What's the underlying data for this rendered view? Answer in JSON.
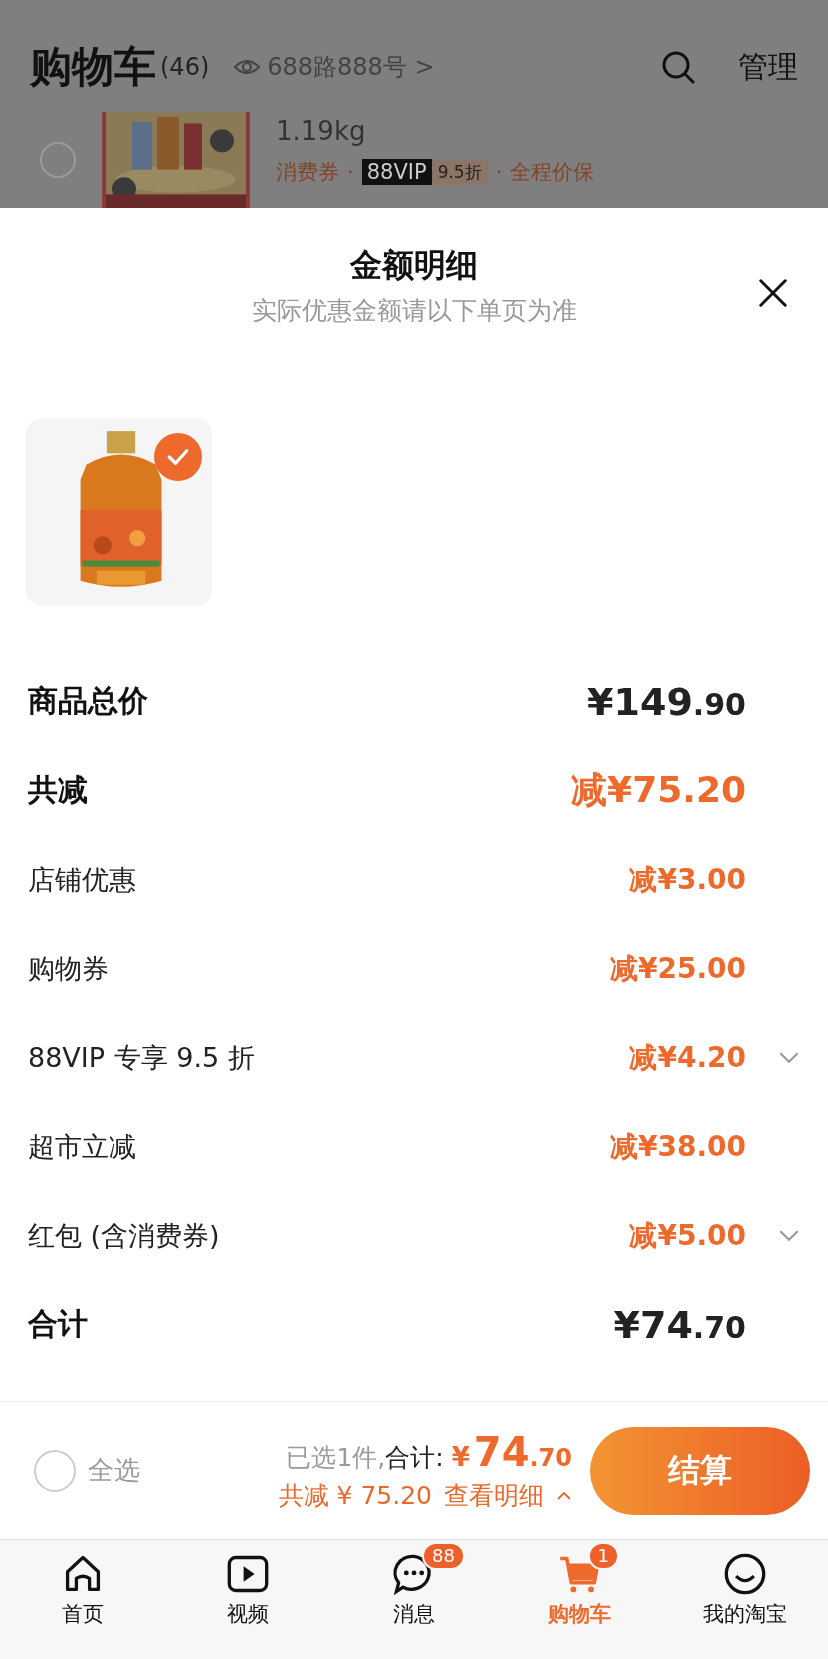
{
  "header": {
    "title": "购物车",
    "count": "(46)",
    "address": "688路888号",
    "address_arrow": ">",
    "manage": "管理"
  },
  "cart_item": {
    "checked": false,
    "spec": "1.19kg",
    "tags": [
      {
        "kind": "text",
        "text": "消费券"
      },
      {
        "kind": "dot",
        "text": "·"
      },
      {
        "kind": "vip",
        "text": "88VIP",
        "discount": "9.5折"
      },
      {
        "kind": "dot",
        "text": "·"
      },
      {
        "kind": "text",
        "text": "全程价保"
      }
    ]
  },
  "sheet": {
    "title": "金额明细",
    "subtitle": "实际优惠金额请以下单页为准",
    "product": {
      "kind": "picture",
      "selected": true
    },
    "rows": [
      {
        "kind": "total",
        "label": "商品总价",
        "value": "¥149",
        "fraction": ".90",
        "expandable": false
      },
      {
        "kind": "discount_total",
        "label": "共减",
        "prefix": "减",
        "value": "¥75.20",
        "expandable": false
      },
      {
        "kind": "line",
        "label": "店铺优惠",
        "prefix": "减",
        "value": "¥3.00",
        "expandable": false
      },
      {
        "kind": "line",
        "label": "购物券",
        "prefix": "减",
        "value": "¥25.00",
        "expandable": false
      },
      {
        "kind": "line",
        "label": "88VIP 专享 9.5 折",
        "prefix": "减",
        "value": "¥4.20",
        "expandable": true
      },
      {
        "kind": "line",
        "label": "超市立减",
        "prefix": "减",
        "value": "¥38.00",
        "expandable": false
      },
      {
        "kind": "line",
        "label": "红包 (含消费券)",
        "prefix": "减",
        "value": "¥5.00",
        "expandable": true
      },
      {
        "kind": "total",
        "label": "合计",
        "value": "¥74",
        "fraction": ".70",
        "expandable": false
      }
    ]
  },
  "checkout_bar": {
    "select_all": {
      "label": "全选",
      "checked": false
    },
    "selected_count": "已选1件,",
    "total_label": "合计:",
    "currency": "¥",
    "total": "74",
    "total_fraction": ".70",
    "discount": "共减 ¥ 75.20",
    "details_link": "查看明细",
    "details_expanded": true,
    "checkout": "结算"
  },
  "tab_bar": [
    {
      "kind": "home",
      "label": "首页",
      "selected": false
    },
    {
      "kind": "video",
      "label": "视频",
      "selected": false
    },
    {
      "kind": "message",
      "label": "消息",
      "selected": false,
      "badge": "88"
    },
    {
      "kind": "cart",
      "label": "购物车",
      "selected": true,
      "badge": "1"
    },
    {
      "kind": "profile",
      "label": "我的淘宝",
      "selected": false
    }
  ]
}
